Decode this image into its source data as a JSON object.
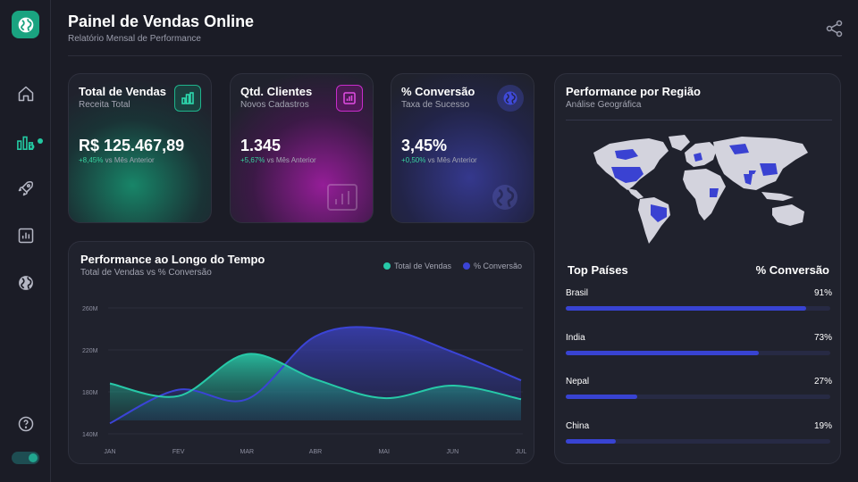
{
  "header": {
    "title": "Painel de Vendas Online",
    "subtitle": "Relatório Mensal de Performance"
  },
  "sidebar": {
    "logo_icon": "globe-icon",
    "items": [
      {
        "icon": "home-icon",
        "active": false
      },
      {
        "icon": "analytics-icon",
        "active": true
      },
      {
        "icon": "rocket-icon",
        "active": false
      },
      {
        "icon": "chart-icon",
        "active": false
      },
      {
        "icon": "globe-icon",
        "active": false
      }
    ],
    "help_icon": "help-icon",
    "theme_toggle": true
  },
  "kpis": [
    {
      "title": "Total de Vendas",
      "subtitle": "Receita Total",
      "value": "R$ 125.467,89",
      "delta": "+8,45%",
      "delta_label": "vs Mês Anterior",
      "icon": "bar-chart-icon",
      "accent": "#19b28a"
    },
    {
      "title": "Qtd. Clientes",
      "subtitle": "Novos Cadastros",
      "value": "1.345",
      "delta": "+5,67%",
      "delta_label": "vs Mês Anterior",
      "icon": "bar-chart-icon",
      "accent": "#c227c6"
    },
    {
      "title": "% Conversão",
      "subtitle": "Taxa de Sucesso",
      "value": "3,45%",
      "delta": "+0,50%",
      "delta_label": "vs Mês Anterior",
      "icon": "globe-icon",
      "accent": "#3c44d4"
    }
  ],
  "performance": {
    "title": "Performance ao Longo do Tempo",
    "subtitle": "Total de Vendas vs % Conversão",
    "legend": [
      {
        "label": "Total de Vendas",
        "color": "#27c9a8"
      },
      {
        "label": "% Conversão",
        "color": "#3b44d6"
      }
    ]
  },
  "chart_data": {
    "type": "area",
    "x": [
      "JAN",
      "FEV",
      "MAR",
      "ABR",
      "MAI",
      "JUN",
      "JUL"
    ],
    "yticks": [
      "260M",
      "220M",
      "180M",
      "140M"
    ],
    "ylim": [
      140,
      260
    ],
    "series": [
      {
        "name": "Total de Vendas",
        "values": [
          188,
          176,
          216,
          192,
          174,
          186,
          173
        ]
      },
      {
        "name": "% Conversão",
        "values": [
          150,
          182,
          173,
          233,
          240,
          218,
          191
        ]
      }
    ]
  },
  "region": {
    "title": "Performance por Região",
    "subtitle": "Análise Geográfica",
    "top_label": "Top Países",
    "conv_label": "% Conversão",
    "countries": [
      {
        "name": "Brasil",
        "pct": "91%",
        "value": 0.91
      },
      {
        "name": "India",
        "pct": "73%",
        "value": 0.73
      },
      {
        "name": "Nepal",
        "pct": "27%",
        "value": 0.27
      },
      {
        "name": "China",
        "pct": "19%",
        "value": 0.19
      }
    ]
  },
  "colors": {
    "background": "#1b1c26",
    "teal": "#27c9a8",
    "blue": "#3b44d6",
    "magenta": "#c227c6",
    "positive": "#38d39f"
  }
}
